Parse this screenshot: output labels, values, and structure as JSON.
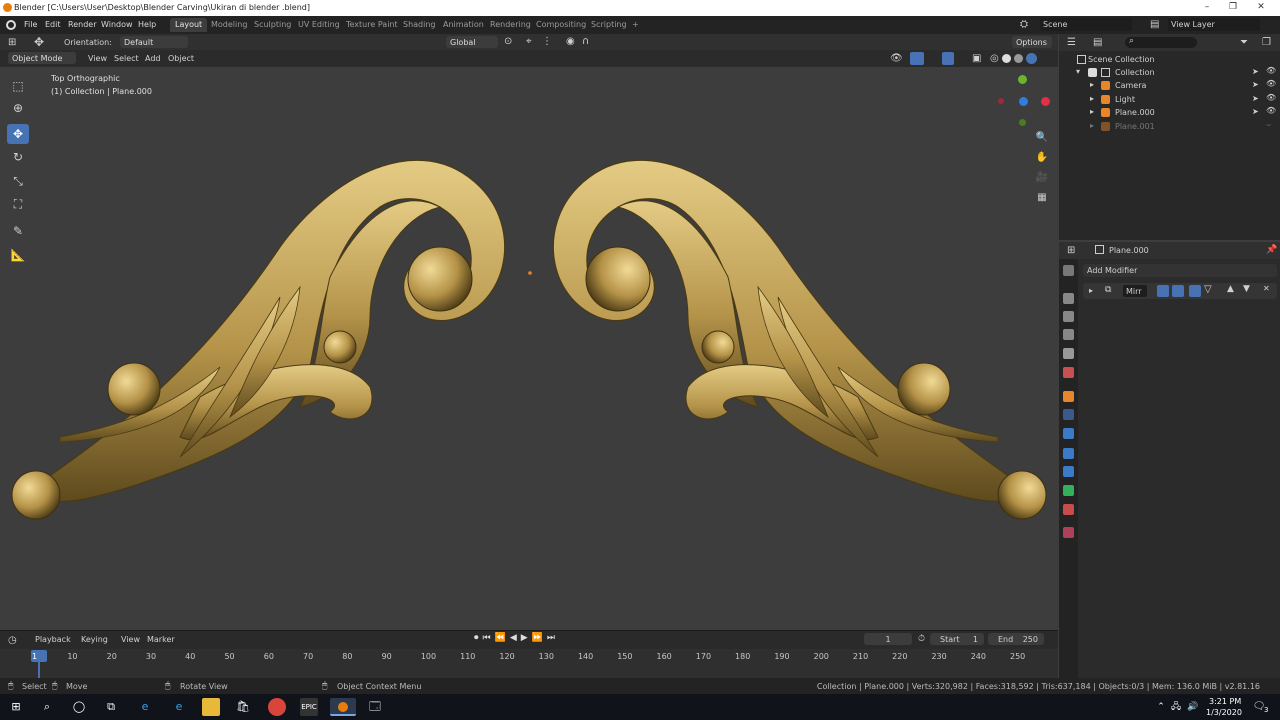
{
  "window": {
    "title": "Blender [C:\\Users\\User\\Desktop\\Blender Carving\\Ukiran di blender .blend]",
    "controls": [
      "–",
      "❐",
      "✕"
    ]
  },
  "menu": {
    "items": [
      "File",
      "Edit",
      "Render",
      "Window",
      "Help"
    ],
    "workspaces": [
      "Layout",
      "Modeling",
      "Sculpting",
      "UV Editing",
      "Texture Paint",
      "Shading",
      "Animation",
      "Rendering",
      "Compositing",
      "Scripting"
    ],
    "active_workspace": "Layout",
    "add_tab": "+",
    "scene_label": "Scene",
    "view_layer_label": "View Layer"
  },
  "tool_header": {
    "orientation_label": "Orientation:",
    "orientation_value": "Default",
    "transform_space": "Global",
    "options_label": "Options"
  },
  "view_header": {
    "mode": "Object Mode",
    "menus": [
      "View",
      "Select",
      "Add",
      "Object"
    ]
  },
  "viewport": {
    "view_name": "Top Orthographic",
    "context": "(1) Collection | Plane.000",
    "ornament_color": "#b89a4e",
    "background": "#3d3d3d"
  },
  "toolbar": {
    "tools": [
      "select-box-icon",
      "cursor-icon",
      "move-icon",
      "rotate-icon",
      "scale-icon",
      "transform-icon",
      "annotate-icon",
      "measure-icon"
    ],
    "active_tool": "move-icon"
  },
  "outliner": {
    "root": "Scene Collection",
    "collection": "Collection",
    "items": [
      {
        "name": "Camera",
        "icon": "camera-icon",
        "dim": false
      },
      {
        "name": "Light",
        "icon": "light-icon",
        "dim": false
      },
      {
        "name": "Plane.000",
        "icon": "mesh-icon",
        "dim": false
      },
      {
        "name": "Plane.001",
        "icon": "mesh-icon",
        "dim": true
      }
    ]
  },
  "properties": {
    "object_name": "Plane.000",
    "add_modifier": "Add Modifier",
    "modifier_name": "Mirr"
  },
  "timeline": {
    "menus": [
      "Playback",
      "Keying",
      "View",
      "Marker"
    ],
    "current_frame": "1",
    "start_label": "Start",
    "start_value": "1",
    "end_label": "End",
    "end_value": "250",
    "ticks": [
      "1",
      "10",
      "20",
      "30",
      "40",
      "50",
      "60",
      "70",
      "80",
      "90",
      "100",
      "110",
      "120",
      "130",
      "140",
      "150",
      "160",
      "170",
      "180",
      "190",
      "200",
      "210",
      "220",
      "230",
      "240",
      "250"
    ]
  },
  "statusbar": {
    "select": "Select",
    "move": "Move",
    "rotate": "Rotate View",
    "context_menu": "Object Context Menu",
    "stats": "Collection | Plane.000 | Verts:320,982 | Faces:318,592 | Tris:637,184 | Objects:0/3 | Mem: 136.0 MiB | v2.81.16"
  },
  "taskbar": {
    "time": "3:21 PM",
    "date": "1/3/2020",
    "notifications": "3"
  }
}
